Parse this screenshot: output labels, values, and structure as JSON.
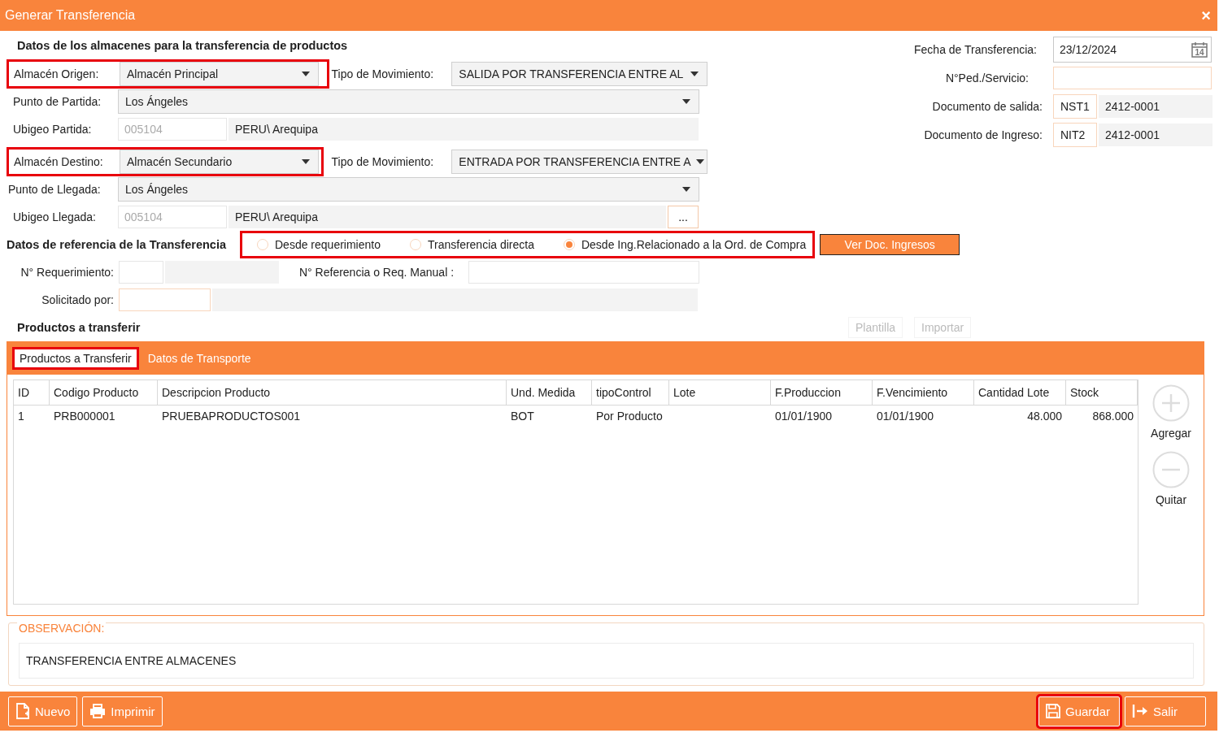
{
  "window": {
    "title": "Generar Transferencia",
    "close": "×"
  },
  "warehouses": {
    "heading": "Datos de los almacenes para la transferencia de productos",
    "origin": {
      "label": "Almacén Origen:",
      "value": "Almacén Principal",
      "highlighted": true
    },
    "origin_movement": {
      "label": "Tipo de Movimiento:",
      "value": "SALIDA POR TRANSFERENCIA ENTRE AL"
    },
    "departure_point": {
      "label": "Punto de Partida:",
      "value": "Los Ángeles"
    },
    "departure_ubigeo": {
      "label": "Ubigeo Partida:",
      "code": "005104",
      "location": "PERU\\ Arequipa"
    },
    "destination": {
      "label": "Almacén Destino:",
      "value": "Almacén Secundario",
      "highlighted": true
    },
    "destination_movement": {
      "label": "Tipo de Movimiento:",
      "value": "ENTRADA POR TRANSFERENCIA ENTRE A"
    },
    "arrival_point": {
      "label": "Punto de Llegada:",
      "value": "Los Ángeles"
    },
    "arrival_ubigeo": {
      "label": "Ubigeo Llegada:",
      "code": "005104",
      "location": "PERU\\ Arequipa",
      "button": "..."
    }
  },
  "documents": [
    {
      "kind": "date",
      "label": "Fecha de Transferencia:",
      "value": "23/12/2024",
      "icon_text": "14"
    },
    {
      "kind": "input",
      "label": "N°Ped./Servicio:"
    },
    {
      "kind": "doc",
      "label": "Documento de salida:",
      "series": "NST1",
      "number": "2412-0001"
    },
    {
      "kind": "doc",
      "label": "Documento de Ingreso:",
      "series": "NIT2",
      "number": "2412-0001"
    }
  ],
  "reference": {
    "heading": "Datos de referencia de la Transferencia",
    "highlighted": true,
    "options": [
      {
        "label": "Desde requerimiento",
        "selected": false
      },
      {
        "label": "Transferencia directa",
        "selected": false
      },
      {
        "label": "Desde Ing.Relacionado a la Ord. de Compra",
        "selected": true
      }
    ],
    "button": "Ver Doc. Ingresos",
    "requirement_label": "N° Requerimiento:",
    "manual_ref_label": "N° Referencia o Req. Manual :",
    "requested_by_label": "Solicitado por:"
  },
  "products": {
    "heading": "Productos a transferir",
    "buttons": [
      {
        "label": "Plantilla",
        "disabled": true
      },
      {
        "label": "Importar",
        "disabled": true
      }
    ],
    "tabs": [
      {
        "label": "Productos a Transferir",
        "selected": true,
        "highlighted": true
      },
      {
        "label": "Datos de Transporte",
        "selected": false,
        "highlighted": false
      }
    ],
    "table": {
      "columns": [
        {
          "label": "ID",
          "kind": "text"
        },
        {
          "label": "Codigo Producto",
          "kind": "text"
        },
        {
          "label": "Descripcion Producto",
          "kind": "text"
        },
        {
          "label": "Und. Medida",
          "kind": "text"
        },
        {
          "label": "tipoControl",
          "kind": "text"
        },
        {
          "label": "Lote",
          "kind": "text"
        },
        {
          "label": "F.Produccion",
          "kind": "text"
        },
        {
          "label": "F.Vencimiento",
          "kind": "text"
        },
        {
          "label": "Cantidad Lote",
          "kind": "number"
        },
        {
          "label": "Stock",
          "kind": "number"
        }
      ],
      "rows": [
        [
          "1",
          "PRB000001",
          "PRUEBAPRODUCTOS001",
          "BOT",
          "Por Producto",
          "",
          "01/01/1900",
          "01/01/1900",
          "48.000",
          "868.000"
        ]
      ]
    },
    "side_actions": [
      {
        "kind": "add",
        "label": "Agregar"
      },
      {
        "kind": "remove",
        "label": "Quitar"
      }
    ]
  },
  "observation": {
    "legend": "OBSERVACIÓN:",
    "value": "TRANSFERENCIA ENTRE ALMACENES"
  },
  "footer": {
    "left": [
      {
        "kind": "new",
        "label": "Nuevo",
        "highlighted": false
      },
      {
        "kind": "print",
        "label": "Imprimir",
        "highlighted": false
      }
    ],
    "right": [
      {
        "kind": "save",
        "label": "Guardar",
        "highlighted": true
      },
      {
        "kind": "exit",
        "label": "Salir",
        "highlighted": false
      }
    ]
  }
}
